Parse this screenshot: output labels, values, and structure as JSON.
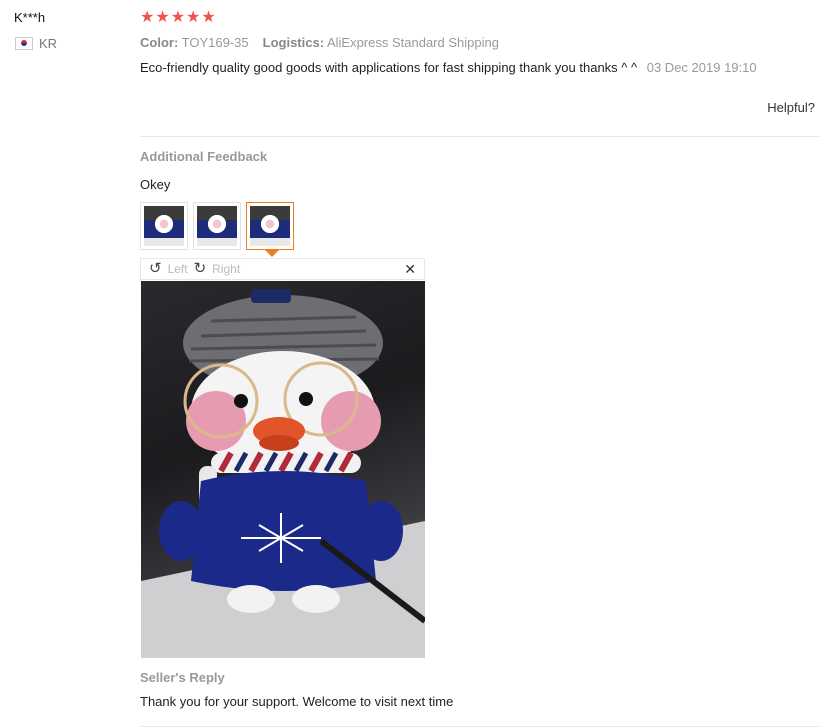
{
  "reviewer": {
    "name": "K***h",
    "country": "KR"
  },
  "rating": {
    "stars": 5,
    "max": 5,
    "color": "#f0524f"
  },
  "meta": {
    "color_label": "Color:",
    "color_value": "TOY169-35",
    "logistics_label": "Logistics:",
    "logistics_value": "AliExpress Standard Shipping"
  },
  "review": {
    "text": "Eco-friendly quality good goods with applications for fast shipping thank you thanks ^ ^",
    "date": "03 Dec 2019 19:10"
  },
  "helpful_label": "Helpful?",
  "additional_feedback": {
    "title": "Additional Feedback",
    "text": "Okey",
    "thumbnails": [
      {
        "active": false
      },
      {
        "active": false
      },
      {
        "active": true
      }
    ]
  },
  "image_viewer": {
    "left_label": "Left",
    "right_label": "Right",
    "rotate_left_icon": "↺",
    "rotate_right_icon": "↻",
    "close_icon": "✕"
  },
  "seller_reply": {
    "title": "Seller's Reply",
    "text": "Thank you for your support. Welcome to visit next time"
  },
  "colors": {
    "accent": "#f07c19"
  }
}
